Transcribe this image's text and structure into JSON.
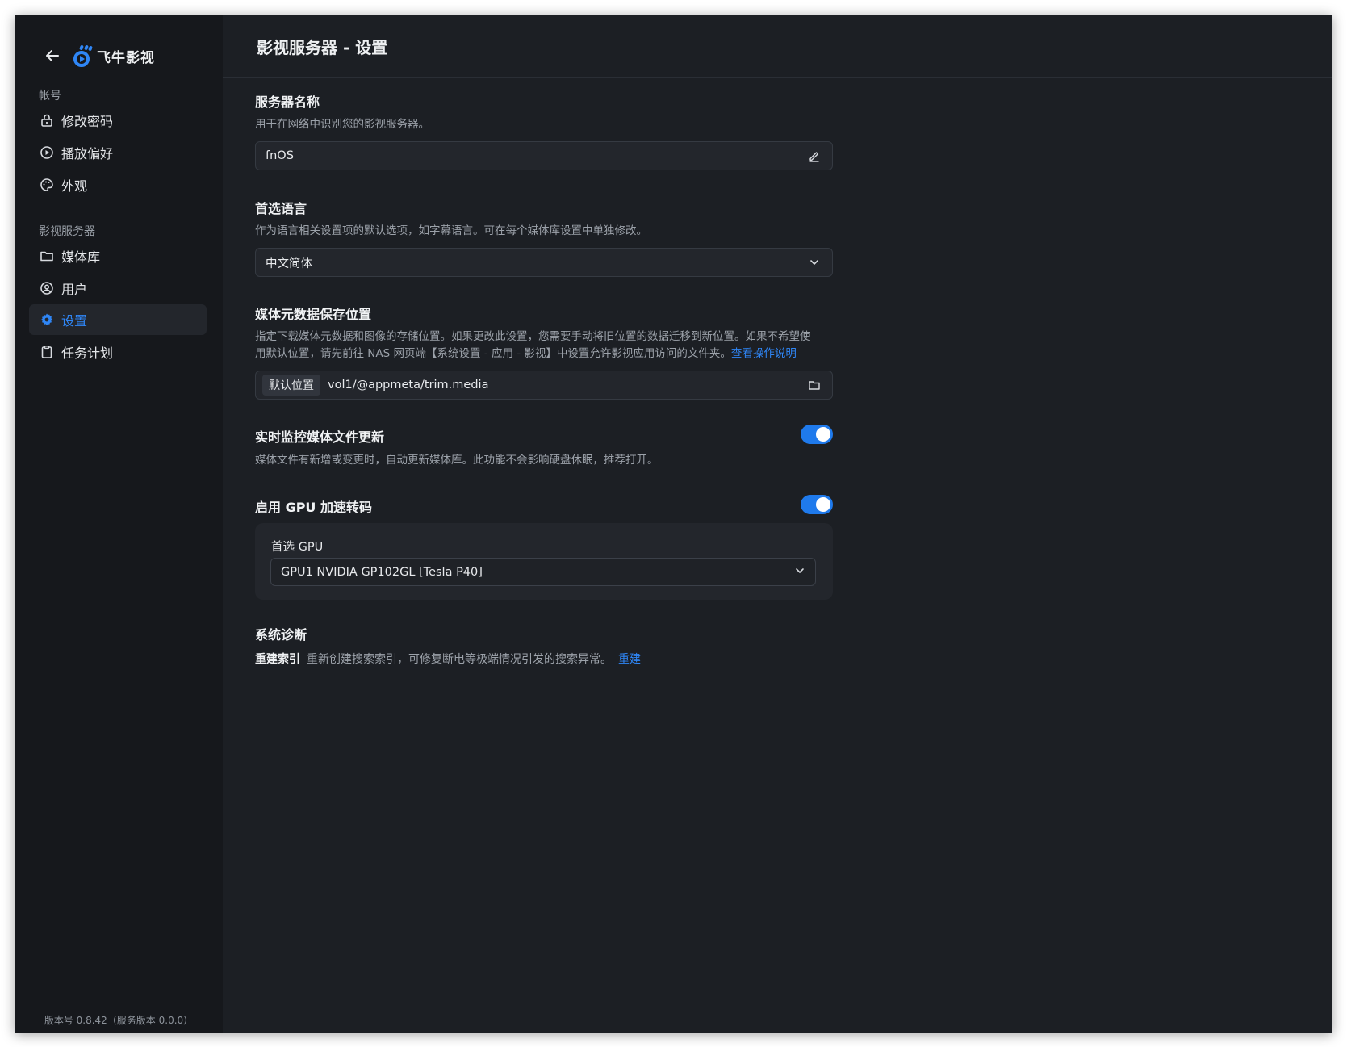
{
  "app": {
    "name": "飞牛影视"
  },
  "sidebar": {
    "section_account": "帐号",
    "account_items": [
      {
        "label": "修改密码",
        "icon": "lock-icon"
      },
      {
        "label": "播放偏好",
        "icon": "play-circle-icon"
      },
      {
        "label": "外观",
        "icon": "palette-icon"
      }
    ],
    "section_server": "影视服务器",
    "server_items": [
      {
        "label": "媒体库",
        "icon": "folder-icon"
      },
      {
        "label": "用户",
        "icon": "user-circle-icon"
      },
      {
        "label": "设置",
        "icon": "gear-icon",
        "active": true
      },
      {
        "label": "任务计划",
        "icon": "clipboard-icon"
      }
    ],
    "version": "版本号 0.8.42（服务版本 0.0.0）"
  },
  "header": {
    "title": "影视服务器 - 设置"
  },
  "server_name": {
    "title": "服务器名称",
    "desc": "用于在网络中识别您的影视服务器。",
    "value": "fnOS"
  },
  "language": {
    "title": "首选语言",
    "desc": "作为语言相关设置项的默认选项，如字幕语言。可在每个媒体库设置中单独修改。",
    "value": "中文简体"
  },
  "metadata": {
    "title": "媒体元数据保存位置",
    "desc_line1": "指定下载媒体元数据和图像的存储位置。如果更改此设置，您需要手动将旧位置的数据迁移到新位置。如果不希望使",
    "desc_line2": "用默认位置，请先前往 NAS 网页端【系统设置 - 应用 - 影视】中设置允许影视应用访问的文件夹。",
    "link": "查看操作说明",
    "tag": "默认位置",
    "path": "vol1/@appmeta/trim.media"
  },
  "monitor": {
    "title": "实时监控媒体文件更新",
    "desc": "媒体文件有新增或变更时，自动更新媒体库。此功能不会影响硬盘休眠，推荐打开。",
    "enabled": true
  },
  "gpu": {
    "title": "启用 GPU 加速转码",
    "enabled": true,
    "preferred_label": "首选 GPU",
    "preferred_value": "GPU1 NVIDIA GP102GL [Tesla P40]"
  },
  "diagnostics": {
    "title": "系统诊断",
    "rebuild_label": "重建索引",
    "rebuild_desc": "重新创建搜索索引，可修复断电等极端情况引发的搜索异常。",
    "rebuild_link": "重建"
  },
  "colors": {
    "accent": "#2f86f6",
    "toggle": "#1f7aec",
    "sidebar_bg": "#16181c",
    "main_bg": "#1c1f24"
  }
}
